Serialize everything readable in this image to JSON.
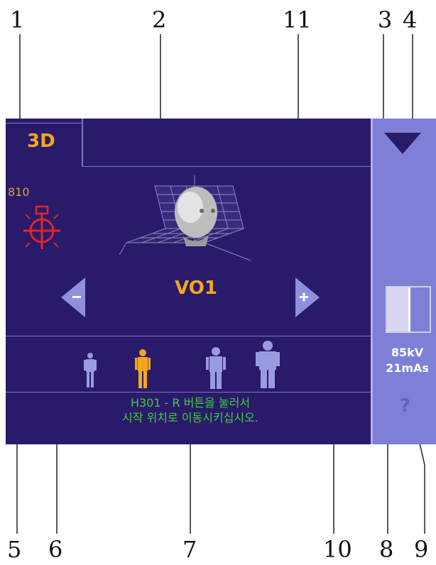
{
  "callouts": {
    "top": [
      "1",
      "2",
      "11",
      "3",
      "4"
    ],
    "bottom": [
      "5",
      "6",
      "7",
      "10",
      "8",
      "9"
    ]
  },
  "screen": {
    "tab_label": "3D",
    "counter": "810",
    "mode": "VO1",
    "status_line1": "H301 - R 버튼을 눌러서",
    "status_line2": "시작 위치로 이동시키십시오.",
    "kv": "85kV",
    "mas": "21mAs",
    "help": "?"
  },
  "colors": {
    "background": "#2a1a6a",
    "side_panel": "#7f7fd8",
    "accent_orange": "#f2a81c",
    "status_green": "#3ecf3e",
    "target_red": "#e0262a",
    "figure_blue": "#9a9ae0"
  },
  "icons": {
    "target": "laser-target-icon",
    "head": "3d-head-icon",
    "left": "arrow-left-minus-icon",
    "right": "arrow-right-plus-icon",
    "down": "triangle-down-icon",
    "collimator": "collimator-icon",
    "patients": [
      "patient-small-icon",
      "patient-child-icon",
      "patient-medium-icon",
      "patient-large-icon"
    ]
  },
  "patient_sizes": {
    "selected_index": 1
  }
}
